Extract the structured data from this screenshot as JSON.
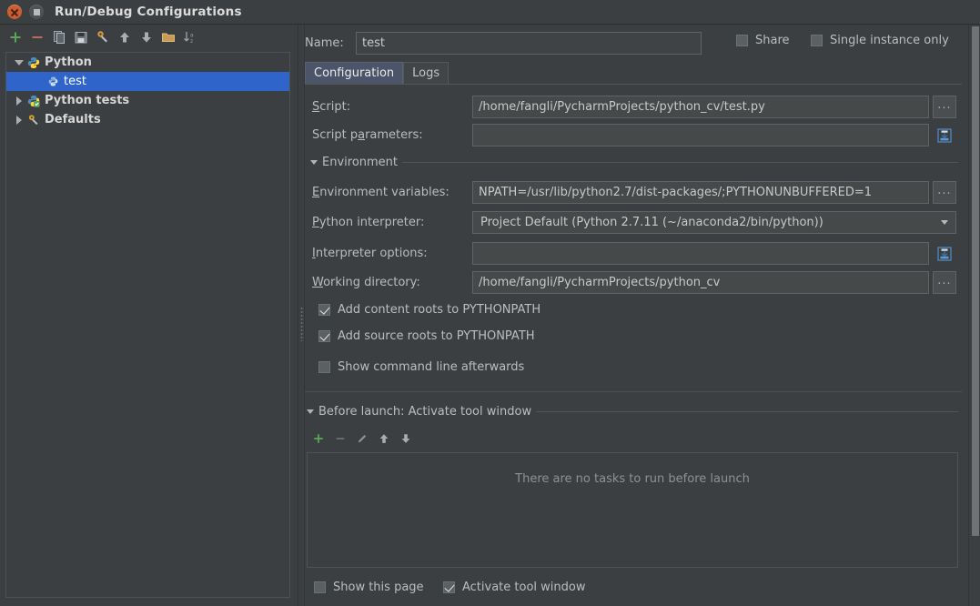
{
  "window": {
    "title": "Run/Debug Configurations",
    "close_label": "Close",
    "maximize_label": "Maximize"
  },
  "sidebar": {
    "toolbar": [
      {
        "name": "add",
        "label": "+",
        "icon": "plus-icon"
      },
      {
        "name": "remove",
        "label": "−",
        "icon": "minus-icon"
      },
      {
        "name": "copy",
        "label": "Copy Configuration",
        "icon": "copy-icon"
      },
      {
        "name": "save",
        "label": "Save Configuration",
        "icon": "save-icon"
      },
      {
        "name": "edit-defaults",
        "label": "Edit defaults",
        "icon": "wrench-icon"
      },
      {
        "name": "move-up",
        "label": "Move Up",
        "icon": "arrow-up-icon"
      },
      {
        "name": "move-down",
        "label": "Move Down",
        "icon": "arrow-down-icon"
      },
      {
        "name": "new-folder",
        "label": "Create new folder",
        "icon": "folder-icon"
      },
      {
        "name": "sort",
        "label": "Sort configurations",
        "icon": "sort-az-icon"
      }
    ],
    "tree": [
      {
        "label": "Python",
        "state": "expanded",
        "icon": "python-icon",
        "indent": 0,
        "bold": true,
        "selected": false
      },
      {
        "label": "test",
        "state": "leaf",
        "icon": "python-file-icon",
        "indent": 1,
        "bold": false,
        "selected": true
      },
      {
        "label": "Python tests",
        "state": "collapsed",
        "icon": "python-tests-icon",
        "indent": 0,
        "bold": true,
        "selected": false
      },
      {
        "label": "Defaults",
        "state": "collapsed",
        "icon": "defaults-icon",
        "indent": 0,
        "bold": true,
        "selected": false
      }
    ]
  },
  "header": {
    "name_label": "Name:",
    "name_value": "test",
    "share": {
      "label": "Share",
      "checked": false
    },
    "single_instance": {
      "label": "Single instance only",
      "checked": false
    }
  },
  "tabs": [
    {
      "label": "Configuration",
      "active": true
    },
    {
      "label": "Logs",
      "active": false
    }
  ],
  "config": {
    "script": {
      "label": "Script:",
      "value": "/home/fangli/PycharmProjects/python_cv/test.py",
      "browse_label": "...",
      "browse_icon": "ellipsis-icon"
    },
    "script_parameters": {
      "label": "Script parameters:",
      "value": "",
      "macro_icon": "insert-macro-icon"
    },
    "environment_section": {
      "label": "Environment",
      "expanded": true
    },
    "environment_variables": {
      "label": "Environment variables:",
      "value": "NPATH=/usr/lib/python2.7/dist-packages/;PYTHONUNBUFFERED=1",
      "browse_label": "...",
      "browse_icon": "ellipsis-icon"
    },
    "python_interpreter": {
      "label": "Python interpreter:",
      "value": "Project Default (Python 2.7.11 (~/anaconda2/bin/python))",
      "dropdown_icon": "chevron-down-icon"
    },
    "interpreter_options": {
      "label": "Interpreter options:",
      "value": "",
      "macro_icon": "insert-macro-icon"
    },
    "working_directory": {
      "label": "Working directory:",
      "value": "/home/fangli/PycharmProjects/python_cv",
      "browse_label": "...",
      "browse_icon": "ellipsis-icon"
    },
    "checkboxes": [
      {
        "label": "Add content roots to PYTHONPATH",
        "checked": true,
        "name": "add-content-roots"
      },
      {
        "label": "Add source roots to PYTHONPATH",
        "checked": true,
        "name": "add-source-roots"
      },
      {
        "label": "Show command line afterwards",
        "checked": false,
        "name": "show-command-line"
      }
    ]
  },
  "before_launch": {
    "section_label": "Before launch: Activate tool window",
    "expanded": true,
    "toolbar": [
      {
        "name": "add-task",
        "label": "Add",
        "icon": "plus-icon",
        "enabled": true
      },
      {
        "name": "remove-task",
        "label": "Remove",
        "icon": "minus-icon",
        "enabled": false
      },
      {
        "name": "edit-task",
        "label": "Edit",
        "icon": "pencil-icon",
        "enabled": false
      },
      {
        "name": "move-task-up",
        "label": "Move up",
        "icon": "arrow-up-icon",
        "enabled": true
      },
      {
        "name": "move-task-down",
        "label": "Move down",
        "icon": "arrow-down-icon",
        "enabled": true
      }
    ],
    "empty_text": "There are no tasks to run before launch",
    "show_this_page": {
      "label": "Show this page",
      "checked": false
    },
    "activate_tool_window": {
      "label": "Activate tool window",
      "checked": true
    }
  },
  "colors": {
    "background": "#3c3f41",
    "field_background": "#45494a",
    "selection": "#2f65ca",
    "tab_active": "#4b5468",
    "accent_green": "#4f9e4f",
    "accent_red": "#b85c52",
    "text": "#bbbbbb"
  }
}
